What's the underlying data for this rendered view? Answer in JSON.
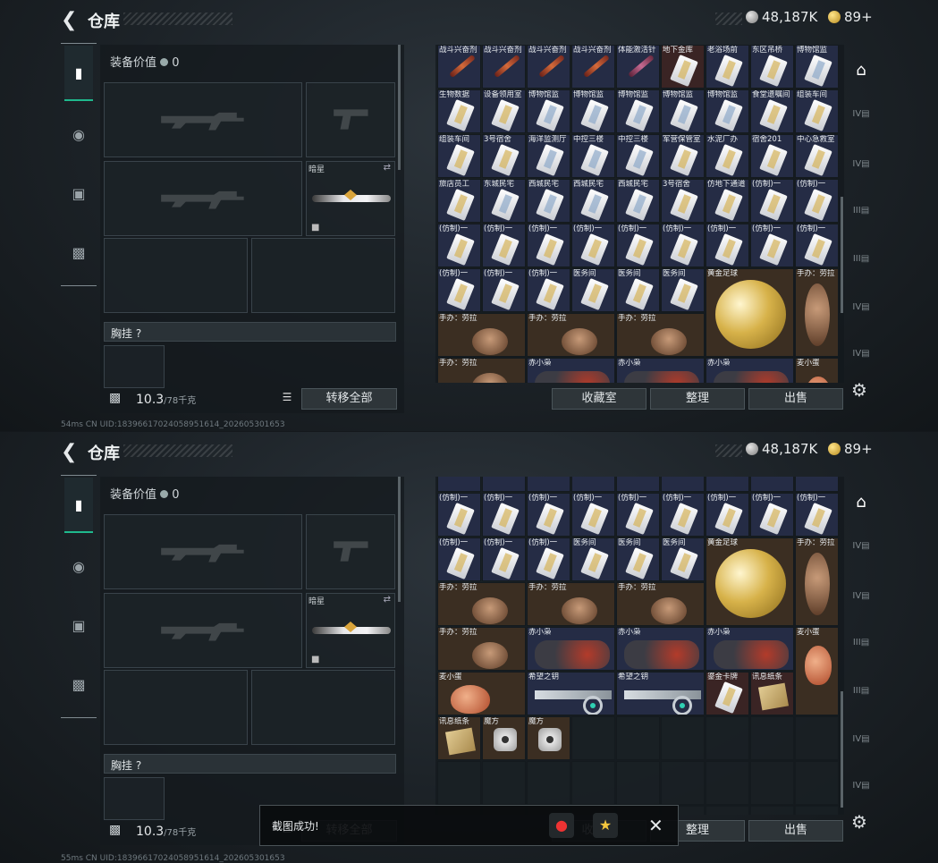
{
  "header": {
    "back_icon": "back-arrow-icon",
    "title": "仓库",
    "silver": "48,187K",
    "gold": "89+"
  },
  "left_nav": {
    "icons": [
      "pistol-icon",
      "helmet-icon",
      "vest-icon",
      "briefcase-icon"
    ]
  },
  "equipment": {
    "value_label": "装备价值",
    "value": "0",
    "melee_label": "暗星",
    "chest_rig_label": "胸挂",
    "chest_rig_help": "?",
    "weight": "10.3",
    "weight_max": "/78千克",
    "transfer_all": "转移全部"
  },
  "stash": {
    "rows_top": [
      [
        "战斗兴奋剂",
        "战斗兴奋剂",
        "战斗兴奋剂",
        "战斗兴奋剂",
        "体能激活针",
        "地下金库",
        "老浴场前",
        "东区吊桥",
        "博物馆监"
      ],
      [
        "生物数据",
        "设备领用室",
        "博物馆监",
        "博物馆监",
        "博物馆监",
        "博物馆监",
        "博物馆监",
        "食堂遗嘱间",
        "组装车间"
      ],
      [
        "组装车间",
        "3号宿舍",
        "海洋监测厅",
        "中控三楼",
        "中控三楼",
        "军营保管室",
        "水泥厂办",
        "宿舍201",
        "中心急救室"
      ],
      [
        "旅店员工",
        "东城民宅",
        "西城民宅",
        "西城民宅",
        "西城民宅",
        "3号宿舍",
        "仿地下通道",
        "(仿制)一",
        "(仿制)一"
      ],
      [
        "(仿制)一",
        "(仿制)一",
        "(仿制)一",
        "(仿制)一",
        "(仿制)一",
        "(仿制)一",
        "(仿制)一",
        "(仿制)一",
        "(仿制)一"
      ],
      [
        "(仿制)一",
        "(仿制)一",
        "(仿制)一",
        "医务间",
        "医务间",
        "医务间",
        "黄金足球",
        "",
        "手办：劳拉"
      ],
      [
        "手办：劳拉",
        "",
        "手办：劳拉",
        "",
        "手办：劳拉",
        "",
        "",
        "",
        ""
      ],
      [
        "手办：劳拉",
        "",
        "赤小枭",
        "",
        "赤小枭",
        "",
        "赤小枭",
        "",
        "麦小蛋"
      ]
    ],
    "rows_bottom": [
      [
        "",
        "",
        "",
        "",
        "",
        "",
        "",
        "",
        ""
      ],
      [
        "(仿制)一",
        "(仿制)一",
        "(仿制)一",
        "(仿制)一",
        "(仿制)一",
        "(仿制)一",
        "(仿制)一",
        "(仿制)一",
        "(仿制)一"
      ],
      [
        "(仿制)一",
        "(仿制)一",
        "(仿制)一",
        "医务间",
        "医务间",
        "医务间",
        "黄金足球",
        "",
        "手办：劳拉"
      ],
      [
        "手办：劳拉",
        "",
        "手办：劳拉",
        "",
        "手办：劳拉",
        "",
        "",
        "",
        ""
      ],
      [
        "手办：劳拉",
        "",
        "赤小枭",
        "",
        "赤小枭",
        "",
        "赤小枭",
        "",
        "麦小蛋"
      ],
      [
        "麦小蛋",
        "",
        "希望之钥",
        "",
        "希望之钥",
        "",
        "鎏金卡牌",
        "讯息纸条",
        ""
      ],
      [
        "讯息纸条",
        "魔方",
        "魔方",
        "",
        "",
        "",
        "",
        "",
        ""
      ]
    ],
    "buttons": {
      "collection": "收藏室",
      "sort": "整理",
      "sell": "出售"
    }
  },
  "right_side": {
    "icons": [
      "home-icon",
      "case-iv-icon",
      "case-iv-icon",
      "case-iii-icon",
      "case-iii-icon",
      "case-iv-icon",
      "case-iv-icon"
    ],
    "settings": "gear-icon"
  },
  "status_bar": {
    "top": "54ms   CN UID:1839661702405895161‌4_202605301653",
    "bottom": "55ms   CN UID:1839661702405895161‌4_202605301653"
  },
  "toast": {
    "text": "截图成功!",
    "close_icon": "close-icon"
  },
  "colors": {
    "accent": "#1fb98d",
    "card_bg": "#252c45",
    "gold_cell": "#3b2e22"
  }
}
